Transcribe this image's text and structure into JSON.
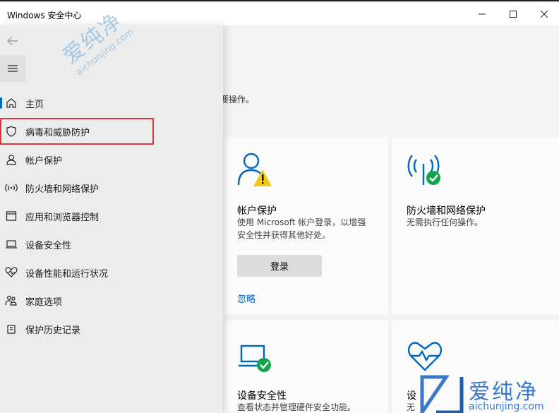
{
  "window": {
    "title": "Windows 安全中心"
  },
  "main": {
    "fragment_text": "必要操作。",
    "cards": [
      {
        "title": "帐户保护",
        "desc": "使用 Microsoft 帐户登录，以增强安全性并获得其他好处。",
        "button": "登录",
        "link": "忽略",
        "status": "warning"
      },
      {
        "title": "防火墙和网络保护",
        "desc": "无需执行任何操作。",
        "status": "ok"
      },
      {
        "title": "设备安全性",
        "desc": "查看状态并管理硬件安全功能。",
        "status": "ok"
      },
      {
        "title": "设",
        "desc": "无",
        "status": "ok"
      }
    ]
  },
  "nav": {
    "items": [
      {
        "label": "主页",
        "icon": "home-icon"
      },
      {
        "label": "病毒和威胁防护",
        "icon": "shield-icon"
      },
      {
        "label": "帐户保护",
        "icon": "person-icon"
      },
      {
        "label": "防火墙和网络保护",
        "icon": "wifi-antenna-icon"
      },
      {
        "label": "应用和浏览器控制",
        "icon": "browser-window-icon"
      },
      {
        "label": "设备安全性",
        "icon": "laptop-icon"
      },
      {
        "label": "设备性能和运行状况",
        "icon": "heart-pulse-icon"
      },
      {
        "label": "家庭选项",
        "icon": "family-icon"
      },
      {
        "label": "保护历史记录",
        "icon": "history-icon"
      }
    ]
  },
  "watermark": {
    "big": "爱纯净",
    "small": "aichunjing.com"
  },
  "colors": {
    "accent": "#0067c0",
    "highlight": "#d9363e",
    "ok": "#16a34a",
    "warn": "#f2c811"
  }
}
